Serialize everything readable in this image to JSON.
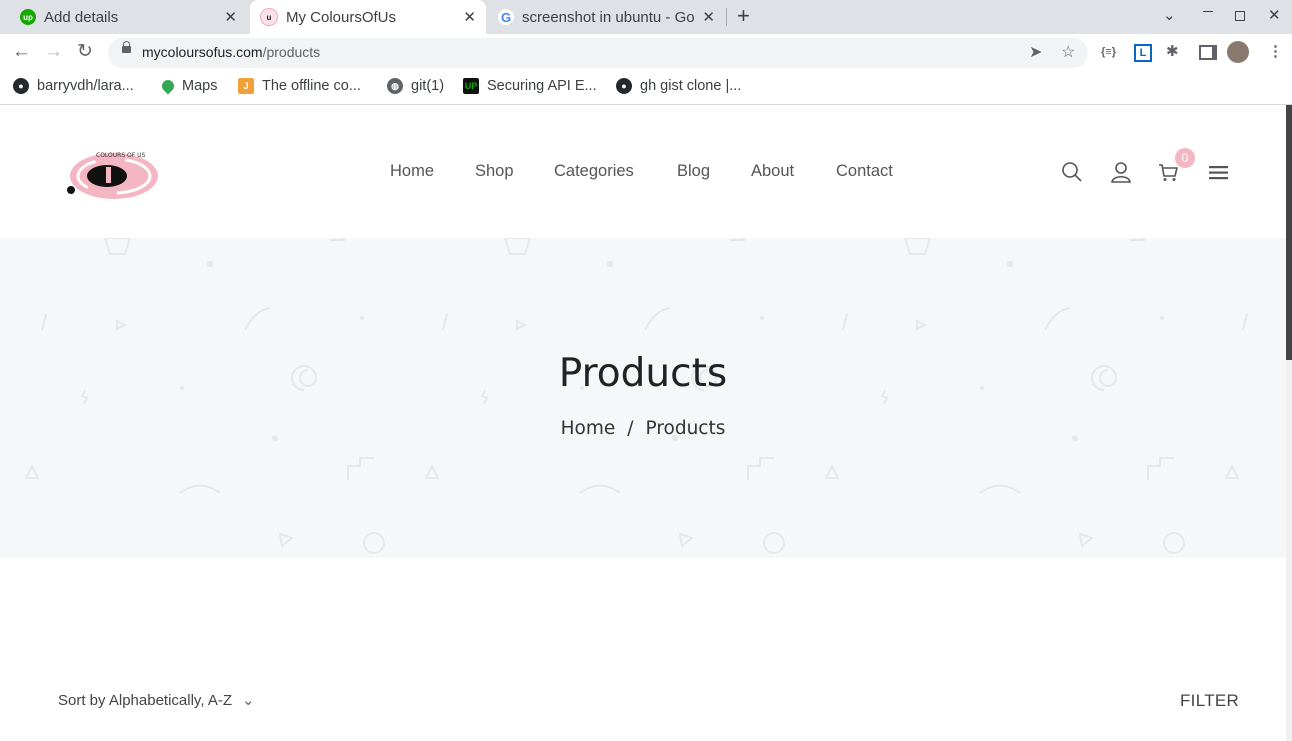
{
  "browser": {
    "tabs": [
      {
        "title": "Add details",
        "favicon": "upwork-icon",
        "color": "#14a800"
      },
      {
        "title": "My ColoursOfUs",
        "favicon": "coloursofus-icon",
        "color": "#f4a6b8"
      },
      {
        "title": "screenshot in ubuntu - Go",
        "favicon": "google-icon",
        "color": "#4285f4"
      }
    ],
    "close_glyph": "✕",
    "new_tab_glyph": "+",
    "url_host": "mycoloursofus.com",
    "url_path": "/products",
    "bookmarks": [
      {
        "label": "barryvdh/lara...",
        "icon": "github-icon",
        "color": "#24292e"
      },
      {
        "label": "Maps",
        "icon": "maps-pin-icon",
        "color": "#34a853"
      },
      {
        "label": "The offline co...",
        "icon": "j-icon",
        "color": "#f0a13a"
      },
      {
        "label": "git(1)",
        "icon": "globe-icon",
        "color": "#5f6368"
      },
      {
        "label": "Securing API E...",
        "icon": "upwork-square-icon",
        "color": "#14a800"
      },
      {
        "label": "gh gist clone |...",
        "icon": "github-icon",
        "color": "#24292e"
      }
    ]
  },
  "site": {
    "nav": [
      "Home",
      "Shop",
      "Categories",
      "Blog",
      "About",
      "Contact"
    ],
    "cart_count": "0",
    "logo_text": "COLOURS OF US",
    "brand_pink": "#f4b6c2"
  },
  "hero": {
    "title": "Products",
    "breadcrumb": {
      "home": "Home",
      "separator": "/",
      "current": "Products"
    }
  },
  "listing": {
    "sort_label": "Sort by",
    "sort_value": "Alphabetically, A-Z",
    "filter_label": "FILTER"
  }
}
